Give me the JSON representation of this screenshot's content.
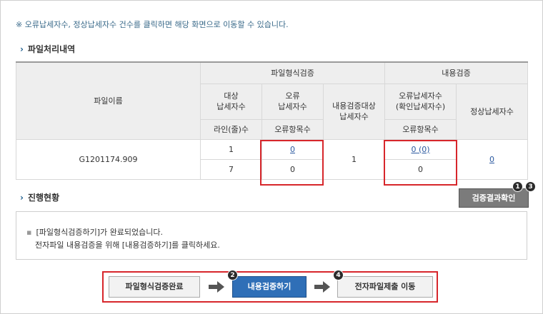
{
  "notice": "※ 오류납세자수, 정상납세자수 건수를 클릭하면 해당 화면으로 이동할 수 있습니다.",
  "file_section_title": "파일처리내역",
  "table": {
    "col_filename": "파일이름",
    "group_format": "파일형식검증",
    "group_content": "내용검증",
    "h_target": "대상\n납세자수",
    "h_error": "오류\n납세자수",
    "h_content_target": "내용검증대상\n납세자수",
    "h_error_confirmed": "오류납세자수\n(확인납세자수)",
    "h_normal": "정상납세자수",
    "sub_lines": "라인(줄)수",
    "sub_error_items": "오류항목수",
    "sub_error_items2": "오류항목수",
    "row": {
      "filename": "G1201174.909",
      "target_count": "1",
      "error_count": "0",
      "lines": "7",
      "error_items": "0",
      "content_target": "1",
      "error_confirmed": "0 (0)",
      "error_items2": "0",
      "normal_count": "0"
    }
  },
  "progress_section_title": "진행현황",
  "confirm_button": "검증결과확인",
  "badges": {
    "b1": "1",
    "b2": "2",
    "b3": "3",
    "b4": "4"
  },
  "status": {
    "line1": "[파일형식검증하기]가 완료되었습니다.",
    "line2": "전자파일 내용검증을 위해 [내용검증하기]를 클릭하세요."
  },
  "steps": {
    "step1": "파일형식검증완료",
    "step2": "내용검증하기",
    "step3": "전자파일제출 이동"
  },
  "colors": {
    "accent_red": "#d7262b",
    "primary_blue": "#2f6fb7",
    "link_blue": "#2c5aa0"
  }
}
